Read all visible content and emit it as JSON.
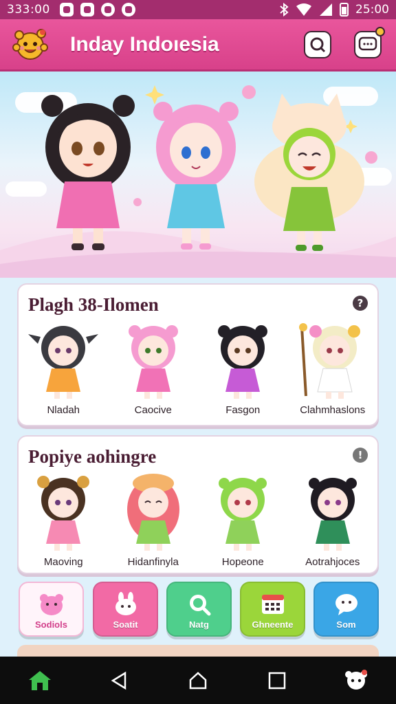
{
  "status_bar": {
    "time": "333:00",
    "clock_right": "25:00"
  },
  "header": {
    "title": "Inday Indoıesia"
  },
  "sections": [
    {
      "title": "Plagh 38-Ilomen",
      "characters": [
        {
          "name": "Nladah",
          "hair": "#3a3a40",
          "dress": "#f7a43c"
        },
        {
          "name": "Caocive",
          "hair": "#f59bd0",
          "dress": "#f172b6"
        },
        {
          "name": "Fasgon",
          "hair": "#232027",
          "dress": "#c65bd6"
        },
        {
          "name": "Clahmhaslons",
          "hair": "#f3ecc6",
          "dress": "#ffffff"
        }
      ]
    },
    {
      "title": "Popiye aohingre",
      "characters": [
        {
          "name": "Maoving",
          "hair": "#4a3222",
          "dress": "#f68ab3"
        },
        {
          "name": "Hidanfinyla",
          "hair": "#f06e7a",
          "dress": "#8fd15a"
        },
        {
          "name": "Hopeone",
          "hair": "#8ed74a",
          "dress": "#8fd15a"
        },
        {
          "name": "Aotrahjoces",
          "hair": "#1f1b22",
          "dress": "#2f8f5a"
        }
      ]
    }
  ],
  "categories": [
    {
      "label": "Sodiols",
      "icon": "bear-icon"
    },
    {
      "label": "Soatit",
      "icon": "bunny-icon"
    },
    {
      "label": "Natg",
      "icon": "search-icon"
    },
    {
      "label": "Ghneente",
      "icon": "calendar-icon"
    },
    {
      "label": "Som",
      "icon": "chat-icon"
    }
  ],
  "colors": {
    "header_pink": "#e04f93",
    "status_bar": "#a32d6e",
    "title_text": "#4a1d33"
  }
}
